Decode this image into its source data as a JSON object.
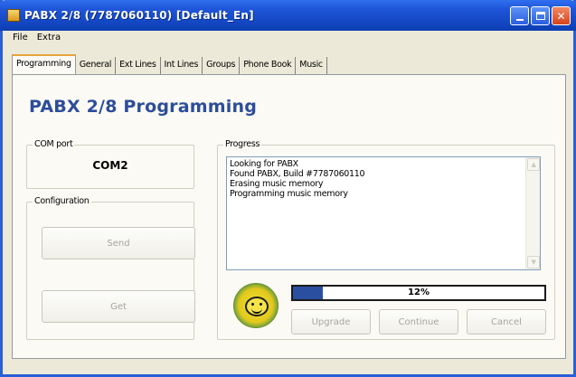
{
  "window": {
    "title": "PABX 2/8 (7787060110) [Default_En]"
  },
  "menu": [
    "File",
    "Extra"
  ],
  "tabs": [
    {
      "label": "Programming",
      "active": true
    },
    {
      "label": "General"
    },
    {
      "label": "Ext Lines"
    },
    {
      "label": "Int Lines"
    },
    {
      "label": "Groups"
    },
    {
      "label": "Phone Book"
    },
    {
      "label": "Music"
    }
  ],
  "main": {
    "heading": "PABX 2/8 Programming",
    "com_port": {
      "label": "COM port",
      "value": "COM2"
    },
    "configuration": {
      "label": "Configuration",
      "send_label": "Send",
      "get_label": "Get"
    },
    "progress": {
      "label": "Progress",
      "log": [
        "Looking for PABX",
        "Found PABX, Build #7787060110",
        "Erasing music memory",
        "Programming music memory"
      ],
      "percent": 12,
      "percent_text": "12%",
      "buttons": {
        "upgrade": "Upgrade",
        "continue": "Continue",
        "cancel": "Cancel"
      }
    }
  },
  "colors": {
    "titlebar": "#1f55d8",
    "heading": "#2d4d9a",
    "progress_fill": "#2b4fa0",
    "active_tab_accent": "#e8a33b"
  }
}
